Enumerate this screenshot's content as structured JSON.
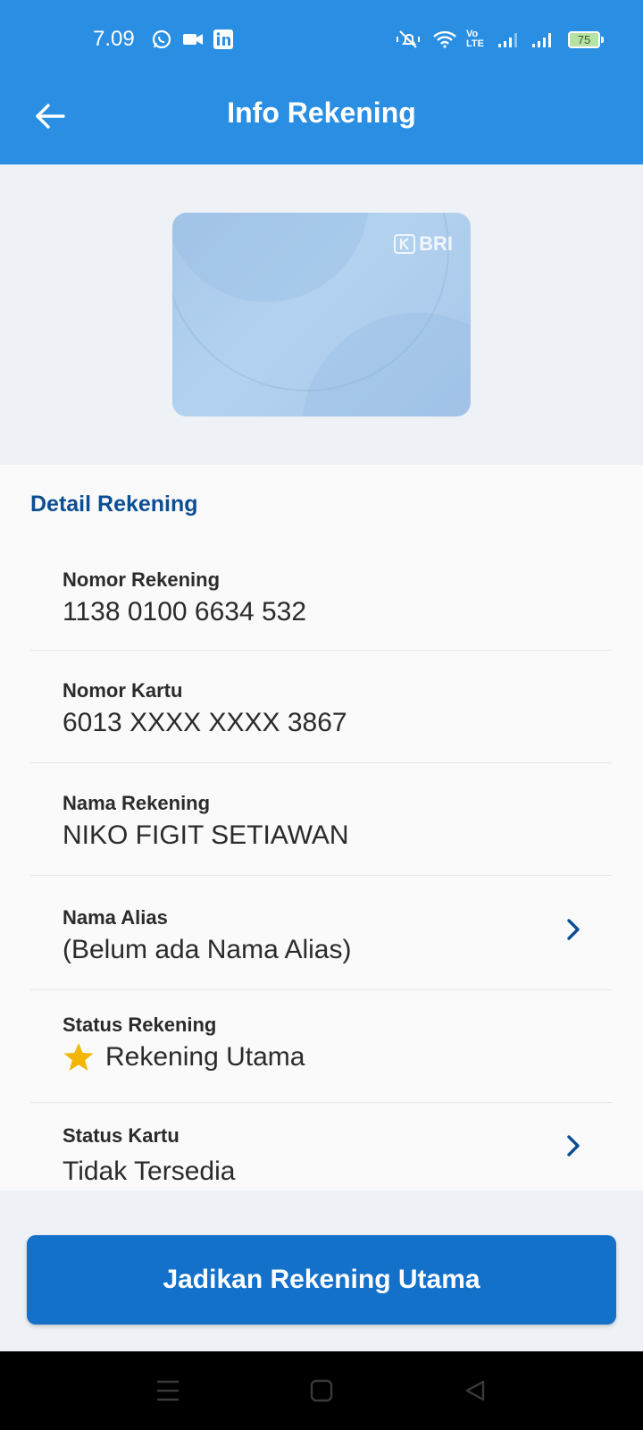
{
  "status_bar": {
    "time": "7.09",
    "volte_label": "Vo LTE",
    "battery_level": "75"
  },
  "header": {
    "title": "Info Rekening"
  },
  "card": {
    "brand": "BRI"
  },
  "detail": {
    "section_title": "Detail Rekening",
    "rows": [
      {
        "label": "Nomor Rekening",
        "value": "1138 0100 6634 532"
      },
      {
        "label": "Nomor Kartu",
        "value": "6013 XXXX XXXX 3867"
      },
      {
        "label": "Nama Rekening",
        "value": "NIKO FIGIT SETIAWAN"
      },
      {
        "label": "Nama Alias",
        "value": "(Belum ada Nama Alias)"
      },
      {
        "label": "Status Rekening",
        "value": "Rekening Utama"
      },
      {
        "label": "Status Kartu",
        "value": "Tidak Tersedia"
      }
    ]
  },
  "cta": {
    "label": "Jadikan Rekening Utama"
  },
  "colors": {
    "header_bg": "#2a8fe3",
    "accent_text": "#0c4e93",
    "button_bg": "#1471ca",
    "star": "#f2b705"
  },
  "icons": [
    "back-arrow-icon",
    "whatsapp-icon",
    "video-icon",
    "linkedin-icon",
    "mute-icon",
    "wifi-icon",
    "signal-icon",
    "battery-icon",
    "chevron-right-icon",
    "star-icon",
    "menu-icon",
    "home-icon",
    "back-triangle-icon"
  ]
}
